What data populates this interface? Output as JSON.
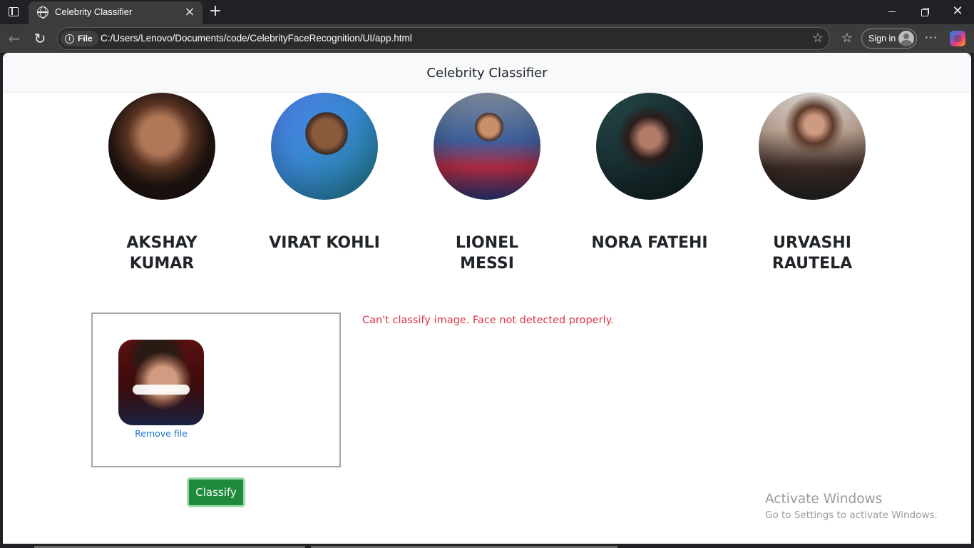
{
  "browser": {
    "tab_title": "Celebrity Classifier",
    "tab_close": "×",
    "new_tab": "+",
    "address_chip": "File",
    "url": "C:/Users/Lenovo/Documents/code/CelebrityFaceRecognition/UI/app.html",
    "sign_in_label": "Sign in",
    "more_label": "···",
    "window_close": "✕"
  },
  "page": {
    "navbar_title": "Celebrity Classifier",
    "celebrities": [
      {
        "name": "AKSHAY KUMAR",
        "photo": "portrait-akshay"
      },
      {
        "name": "VIRAT KOHLI",
        "photo": "portrait-virat"
      },
      {
        "name": "LIONEL MESSI",
        "photo": "portrait-messi"
      },
      {
        "name": "NORA FATEHI",
        "photo": "portrait-nora"
      },
      {
        "name": "URVASHI RAUTELA",
        "photo": "portrait-urvashi"
      }
    ],
    "dropzone": {
      "remove_link": "Remove file"
    },
    "classify_button": "Classify",
    "error_message": "Can't classify image. Face not detected properly."
  },
  "os_overlay": {
    "watermark_title": "Activate Windows",
    "watermark_subtitle": "Go to Settings to activate Windows."
  },
  "colors": {
    "error": "#dc3545",
    "classify_button": "#1f8a3a",
    "link": "#1a7ad1"
  }
}
